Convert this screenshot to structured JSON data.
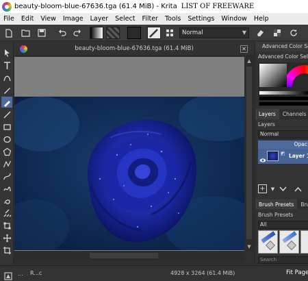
{
  "window": {
    "title": "beauty-bloom-blue-67636.tga (61.4 MiB)  - Krita",
    "watermark": "LIST OF FREEWARE"
  },
  "menu": [
    "File",
    "Edit",
    "View",
    "Image",
    "Layer",
    "Select",
    "Filter",
    "Tools",
    "Settings",
    "Window",
    "Help"
  ],
  "toolbar": {
    "blend_mode": "Normal"
  },
  "document": {
    "tab_title": "beauty-bloom-blue-67636.tga (61.4 MiB)"
  },
  "dock": {
    "advanced_tab": "Advanced Color Sel",
    "advanced_title": "Advanced Color Selecto",
    "tabs": [
      "Layers",
      "Channels"
    ],
    "layers_label": "Layers",
    "layers_blend": "Normal",
    "opacity_header": "Opac",
    "layer_name": "Layer 1",
    "brush_tabs": [
      "Brush Presets",
      "Bru"
    ],
    "brush_presets_label": "Brush Presets",
    "brush_filter": "All",
    "search_placeholder": "Search"
  },
  "status": {
    "dots": "...",
    "brush": "R...c",
    "image_size": "4928 x 3264 (61.4 MiB)",
    "zoom": "Fit Page"
  },
  "colors": {
    "bg": "#313131",
    "panel": "#333333",
    "selection": "#476496",
    "accent_blue": "#4e6aa1"
  },
  "icons": {
    "tools": [
      "pointer-icon",
      "text-icon",
      "edit-shapes-icon",
      "calligraphy-icon",
      "brush-icon",
      "line-icon",
      "rectangle-icon",
      "ellipse-icon",
      "polygon-icon",
      "polyline-icon",
      "bezier-icon",
      "freehand-path-icon",
      "dynamic-brush-icon",
      "multibrush-icon",
      "transform-icon",
      "move-icon",
      "crop-icon"
    ]
  }
}
